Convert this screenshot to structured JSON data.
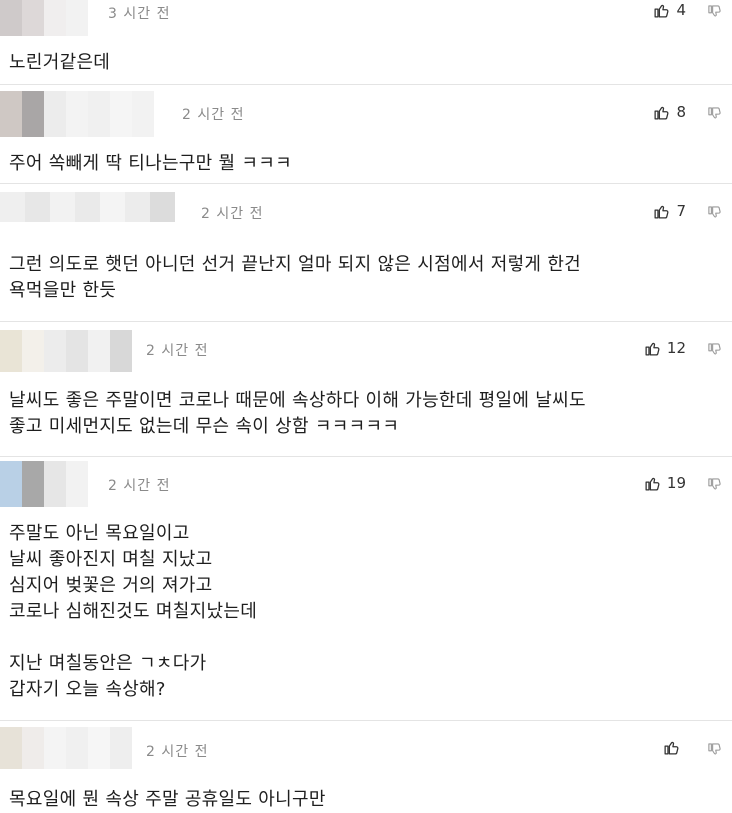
{
  "comments": [
    {
      "time": "3 시간 전",
      "likes": "4",
      "text": "노린거같은데"
    },
    {
      "time": "2 시간 전",
      "likes": "8",
      "text": "주어 쏙빼게 딱 티나는구만 뭘 ㅋㅋㅋ"
    },
    {
      "time": "2 시간 전",
      "likes": "7",
      "text": "그런 의도로 햇던 아니던 선거 끝난지 얼마 되지 않은 시점에서 저렇게 한건\n욕먹을만 한듯"
    },
    {
      "time": "2 시간 전",
      "likes": "12",
      "text": "날씨도 좋은 주말이면 코로나 때문에 속상하다 이해 가능한데 평일에 날씨도\n좋고 미세먼지도 없는데 무슨 속이 상함 ㅋㅋㅋㅋㅋ"
    },
    {
      "time": "2 시간 전",
      "likes": "19",
      "text": "주말도 아닌 목요일이고\n날씨 좋아진지 며칠 지났고\n심지어 벚꽃은 거의 져가고\n코로나 심해진것도 며칠지났는데\n\n지난 며칠동안은 ㄱㅊ다가\n갑자기 오늘 속상해?"
    },
    {
      "time": "2 시간 전",
      "likes": "",
      "text": "목요일에 뭔 속상 주말 공휴일도 아니구만"
    }
  ],
  "icons": {
    "like": "thumbs-up-icon",
    "dislike": "thumbs-down-icon"
  },
  "colors": {
    "time": "#8a8a8a",
    "divider": "#e4e4e4",
    "text": "#1e1e1e"
  }
}
